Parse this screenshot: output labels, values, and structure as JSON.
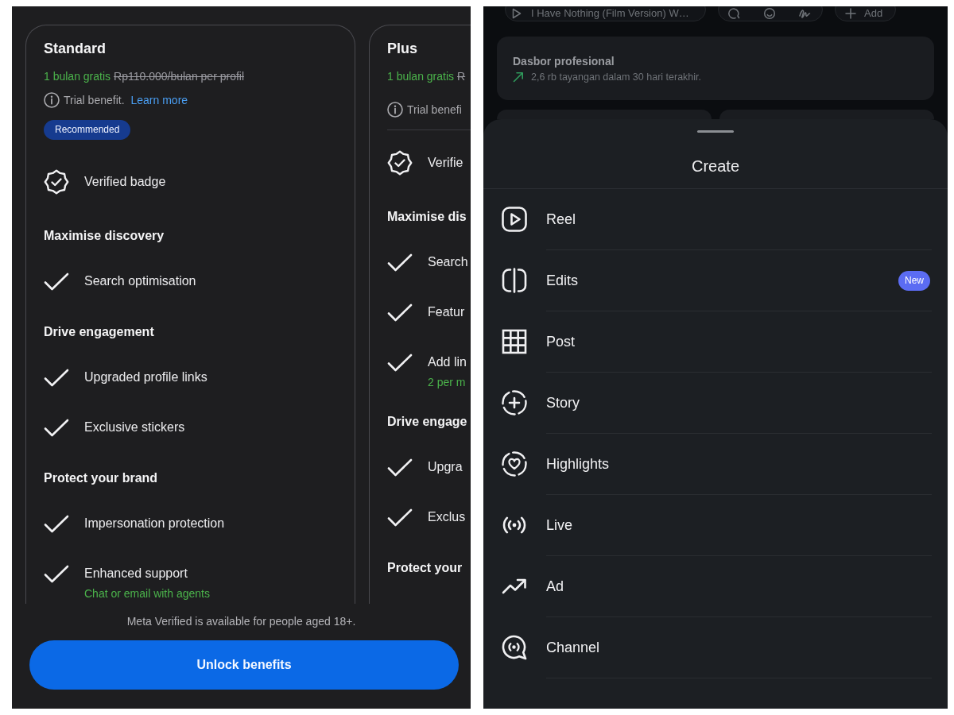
{
  "plans_screen": {
    "plans": [
      {
        "name": "Standard",
        "offer": "1 bulan gratis",
        "old_price": "Rp110.000/bulan per profil",
        "trial_note": "Trial benefit.",
        "trial_link": "Learn more",
        "badge": "Recommended",
        "features": [
          {
            "kind": "verified",
            "label": "Verified badge"
          },
          {
            "kind": "heading",
            "label": "Maximise discovery"
          },
          {
            "kind": "check",
            "label": "Search optimisation"
          },
          {
            "kind": "heading",
            "label": "Drive engagement"
          },
          {
            "kind": "check",
            "label": "Upgraded profile links"
          },
          {
            "kind": "check",
            "label": "Exclusive stickers"
          },
          {
            "kind": "heading",
            "label": "Protect your brand"
          },
          {
            "kind": "check",
            "label": "Impersonation protection"
          },
          {
            "kind": "check",
            "label": "Enhanced support",
            "note": "Chat or email with agents"
          }
        ]
      },
      {
        "name": "Plus",
        "offer": "1 bulan gratis",
        "old_price": "R",
        "trial_note": "Trial benefi",
        "features": [
          {
            "kind": "verified",
            "label": "Verifie"
          },
          {
            "kind": "heading",
            "label": "Maximise dis"
          },
          {
            "kind": "check",
            "label": "Search"
          },
          {
            "kind": "check",
            "label": "Featur"
          },
          {
            "kind": "check",
            "label": "Add lin",
            "note": "2 per m"
          },
          {
            "kind": "heading",
            "label": "Drive engage"
          },
          {
            "kind": "check",
            "label": "Upgra"
          },
          {
            "kind": "check",
            "label": "Exclus"
          },
          {
            "kind": "heading",
            "label": "Protect your"
          }
        ]
      }
    ],
    "age_note": "Meta Verified is available for people aged 18+.",
    "primary_button": "Unlock benefits"
  },
  "create_screen": {
    "background": {
      "chips": [
        {
          "kind": "audio",
          "label": "I Have Nothing (Film Version) W…"
        },
        {
          "kind": "tools"
        },
        {
          "kind": "add",
          "label": "Add"
        }
      ],
      "dashboard": {
        "title": "Dasbor profesional",
        "summary": "2,6 rb tayangan dalam 30 hari terakhir."
      }
    },
    "sheet": {
      "title": "Create",
      "items": [
        {
          "label": "Reel"
        },
        {
          "label": "Edits",
          "badge": "New"
        },
        {
          "label": "Post"
        },
        {
          "label": "Story"
        },
        {
          "label": "Highlights"
        },
        {
          "label": "Live"
        },
        {
          "label": "Ad"
        },
        {
          "label": "Channel"
        }
      ]
    }
  }
}
